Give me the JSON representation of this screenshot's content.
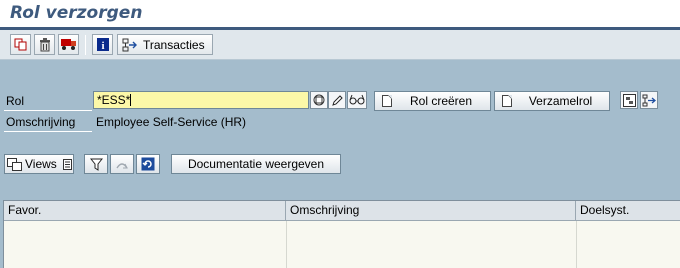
{
  "window": {
    "title": "Rol verzorgen"
  },
  "toolbar": {
    "icons": [
      "copy-icon",
      "delete-icon",
      "transport-icon",
      "info-icon",
      "transactions-icon"
    ],
    "transactions_label": "Transacties"
  },
  "form": {
    "rol_label": "Rol",
    "rol_value": "*ESS*",
    "omschrijving_label": "Omschrijving",
    "omschrijving_value": "Employee Self-Service (HR)",
    "create_role_label": "Rol creëren",
    "composite_role_label": "Verzamelrol"
  },
  "view_toolbar": {
    "views_label": "Views",
    "documentation_label": "Documentatie weergeven"
  },
  "grid": {
    "columns": [
      "Favor.",
      "Omschrijving",
      "Doelsyst."
    ]
  },
  "colors": {
    "background": "#a4bccc",
    "title": "#3e5a7e",
    "input_highlight": "#fcf8a8"
  }
}
